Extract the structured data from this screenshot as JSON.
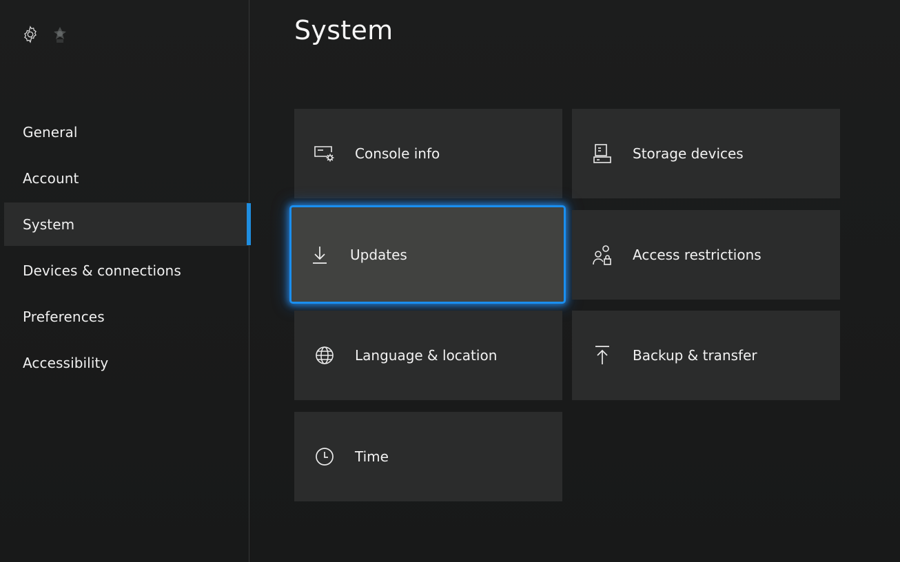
{
  "header": {
    "title": "System"
  },
  "sidebar": {
    "items": [
      {
        "label": "General"
      },
      {
        "label": "Account"
      },
      {
        "label": "System"
      },
      {
        "label": "Devices & connections"
      },
      {
        "label": "Preferences"
      },
      {
        "label": "Accessibility"
      }
    ],
    "selected": "System"
  },
  "tiles": {
    "console_info": {
      "label": "Console info",
      "icon": "console-info-icon"
    },
    "storage_devices": {
      "label": "Storage devices",
      "icon": "storage-icon"
    },
    "updates": {
      "label": "Updates",
      "icon": "download-arrow-icon"
    },
    "access_restrictions": {
      "label": "Access restrictions",
      "icon": "users-lock-icon"
    },
    "language_location": {
      "label": "Language & location",
      "icon": "globe-icon"
    },
    "backup_transfer": {
      "label": "Backup & transfer",
      "icon": "upload-arrow-icon"
    },
    "time": {
      "label": "Time",
      "icon": "clock-icon"
    }
  },
  "colors": {
    "accent": "#1a8ff0",
    "tile": "#2b2c2c",
    "tile_focused": "#414240",
    "background": "#1a1b1b"
  }
}
